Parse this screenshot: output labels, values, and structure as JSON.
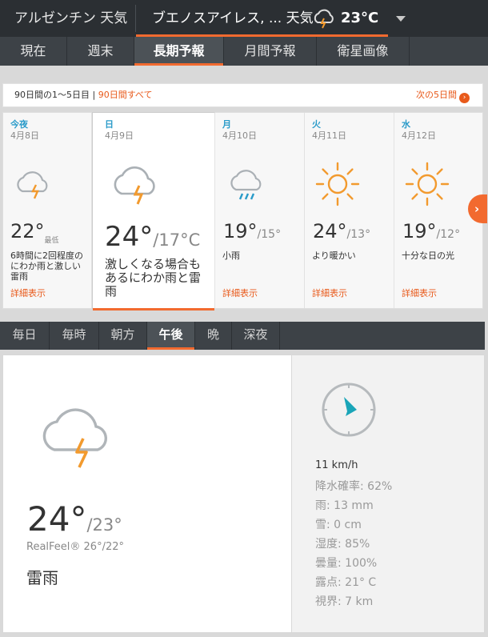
{
  "header": {
    "region": "アルゼンチン 天気",
    "location": "ブエノスアイレス, ... 天気",
    "current_temp": "23°C",
    "current_icon": "thunderstorm-icon"
  },
  "nav": {
    "tabs": [
      {
        "label": "現在",
        "active": false
      },
      {
        "label": "週末",
        "active": false
      },
      {
        "label": "長期予報",
        "active": true
      },
      {
        "label": "月間予報",
        "active": false
      },
      {
        "label": "衛星画像",
        "active": false
      }
    ]
  },
  "range": {
    "info": "90日間の1～5日目",
    "all_link": "90日間すべて",
    "next_link": "次の5日間"
  },
  "days": [
    {
      "name": "今夜",
      "date": "4月8日",
      "hi": "22°",
      "lo": "",
      "low_tag": "最低",
      "desc": "6時間に2回程度のにわか雨と激しい雷雨",
      "more": "詳細表示",
      "icon": "thunderstorm-icon"
    },
    {
      "name": "日",
      "date": "4月9日",
      "hi": "24°",
      "lo": "/17°C",
      "low_tag": "",
      "desc": "激しくなる場合もあるにわか雨と雷雨",
      "more": "",
      "icon": "thunderstorm-icon"
    },
    {
      "name": "月",
      "date": "4月10日",
      "hi": "19°",
      "lo": "/15°",
      "low_tag": "",
      "desc": "小雨",
      "more": "詳細表示",
      "icon": "rain-icon"
    },
    {
      "name": "火",
      "date": "4月11日",
      "hi": "24°",
      "lo": "/13°",
      "low_tag": "",
      "desc": "より暖かい",
      "more": "詳細表示",
      "icon": "sunny-icon"
    },
    {
      "name": "水",
      "date": "4月12日",
      "hi": "19°",
      "lo": "/12°",
      "low_tag": "",
      "desc": "十分な日の光",
      "more": "詳細表示",
      "icon": "sunny-icon"
    }
  ],
  "period_tabs": [
    {
      "label": "毎日",
      "active": false
    },
    {
      "label": "毎時",
      "active": false
    },
    {
      "label": "朝方",
      "active": false
    },
    {
      "label": "午後",
      "active": true
    },
    {
      "label": "晩",
      "active": false
    },
    {
      "label": "深夜",
      "active": false
    }
  ],
  "detail": {
    "hi": "24°",
    "lo": "/23°",
    "realfeel": "RealFeel® 26°/22°",
    "desc": "雷雨",
    "icon": "thunderstorm-icon",
    "wind": "11 km/h",
    "stats": [
      "降水確率: 62%",
      "雨: 13 mm",
      "雪: 0 cm",
      "湿度: 85%",
      "曇量: 100%",
      "露点: 21° C",
      "視界: 7 km"
    ]
  },
  "colors": {
    "accent": "#f26a2f",
    "link": "#e85a1b",
    "dayname": "#2a9bc9",
    "compass": "#1aa5b8"
  }
}
